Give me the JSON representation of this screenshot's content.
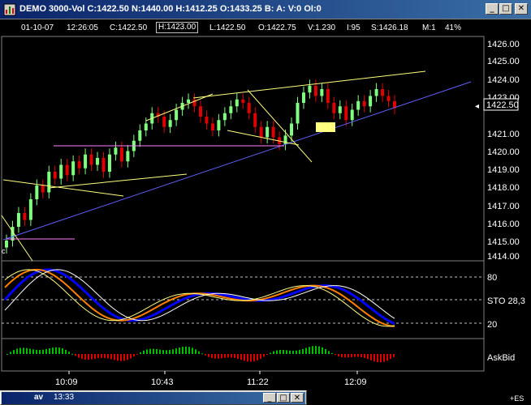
{
  "window": {
    "title": "DEMO 3000-Vol C:1422.50 N:1440.00 H:1412.25 O:1433.25 B: A: V:0 OI:0",
    "min_label": "_",
    "max_label": "□",
    "close_label": "✕"
  },
  "infobar": {
    "date": "01-10-07",
    "time": "12:26:05",
    "close": "C:1422.50",
    "high": "H:1423.00",
    "low": "L:1422.50",
    "open": "O:1422.75",
    "vol": "V:1.230",
    "i": "I:95",
    "s": "S:1426.18",
    "m": "M:1",
    "pct": "41%"
  },
  "price_axis": {
    "labels": [
      "1426.00",
      "1425.00",
      "1424.00",
      "1423.00",
      "1422.50",
      "1421.00",
      "1420.00",
      "1419.00",
      "1418.00",
      "1417.00",
      "1416.00",
      "1415.00",
      "1414.00"
    ],
    "current": "1422.50"
  },
  "sto_axis": {
    "upper": "80",
    "label": "STO 28,3",
    "lower": "20"
  },
  "askbid_label": "AskBid",
  "time_axis": [
    "10:09",
    "10:43",
    "11:22",
    "12:09"
  ],
  "mini_window": {
    "title": "av",
    "time": "13:33"
  },
  "symbol_label": "+ES",
  "colors": {
    "up": "#80ff80",
    "down": "#e00000",
    "trendline": "#ffff80",
    "channel": "#6060ff",
    "horizontal": "#ff80ff",
    "sto_orange": "#ff8000",
    "sto_blue": "#0000ff",
    "sto_white": "#ffffff",
    "sto_yellow": "#ffff80"
  },
  "chart_data": {
    "type": "candlestick",
    "price_range": [
      1414.0,
      1426.0
    ],
    "closes": [
      1414.8,
      1415.6,
      1416.4,
      1416.0,
      1417.2,
      1418.0,
      1417.6,
      1418.8,
      1418.4,
      1419.2,
      1418.6,
      1419.4,
      1419.0,
      1419.8,
      1419.2,
      1419.6,
      1418.8,
      1419.8,
      1420.2,
      1419.4,
      1420.0,
      1420.6,
      1421.2,
      1421.6,
      1422.2,
      1422.0,
      1421.4,
      1421.8,
      1422.4,
      1422.8,
      1423.0,
      1422.6,
      1422.0,
      1421.6,
      1421.2,
      1421.8,
      1422.2,
      1422.6,
      1423.0,
      1422.8,
      1422.2,
      1421.4,
      1420.8,
      1421.4,
      1420.8,
      1420.4,
      1420.9,
      1421.6,
      1422.8,
      1423.4,
      1423.8,
      1423.2,
      1423.6,
      1422.8,
      1422.2,
      1422.6,
      1421.8,
      1422.4,
      1422.9,
      1422.6,
      1423.2,
      1423.6,
      1423.2,
      1422.9,
      1422.5
    ],
    "sto_upper": 80,
    "sto_lower": 20
  }
}
